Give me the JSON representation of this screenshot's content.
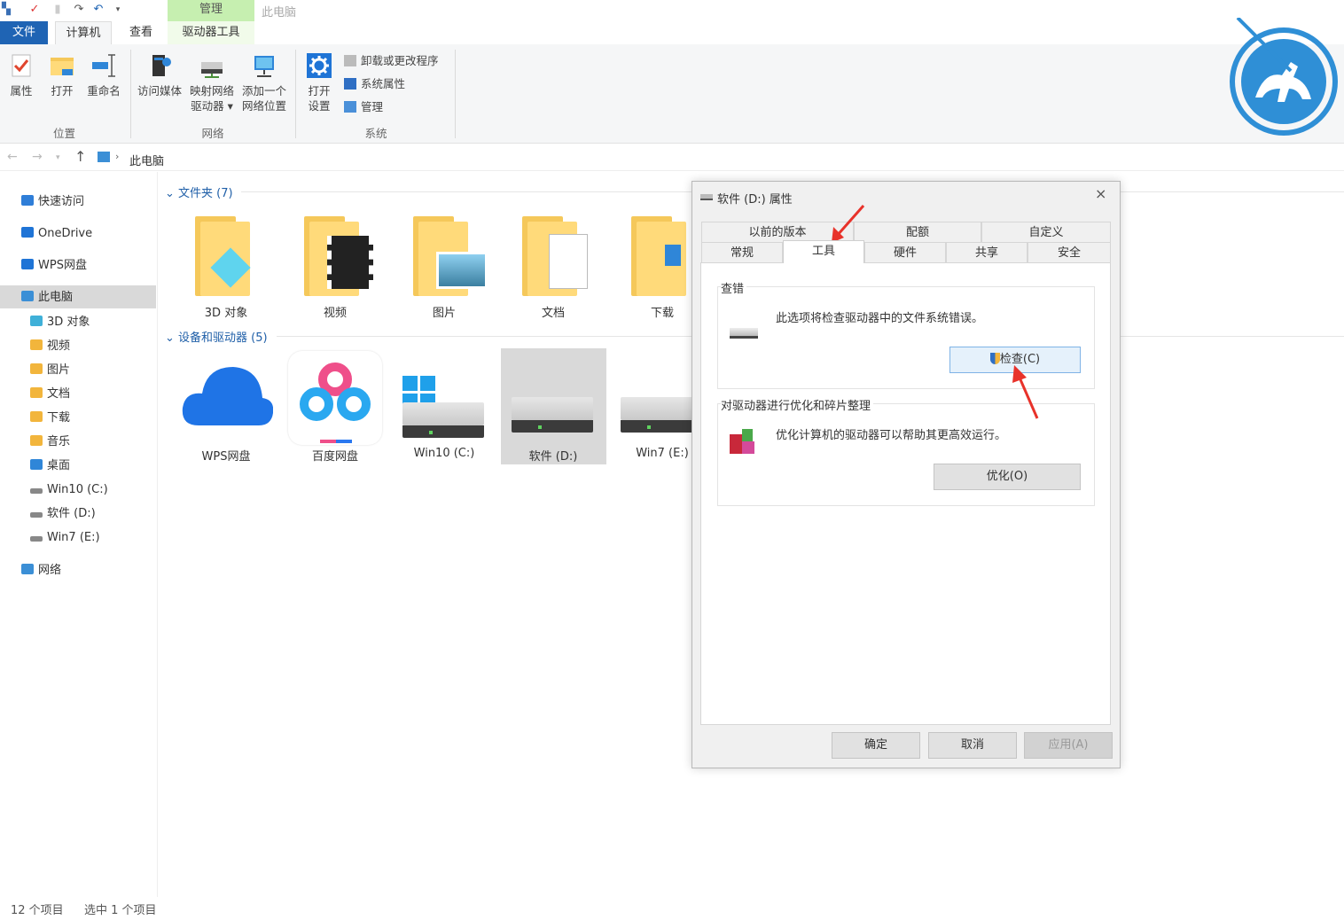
{
  "titlebar": {
    "context_group": "管理",
    "title": "此电脑"
  },
  "ribbon": {
    "tabs": [
      "文件",
      "计算机",
      "查看",
      "驱动器工具"
    ],
    "location": {
      "label": "位置",
      "buttons": [
        "属性",
        "打开",
        "重命名"
      ]
    },
    "network": {
      "label": "网络",
      "access_media": "访问媒体",
      "map_drive_l1": "映射网络",
      "map_drive_l2": "驱动器",
      "add_location_l1": "添加一个",
      "add_location_l2": "网络位置"
    },
    "system": {
      "label": "系统",
      "open_settings_l1": "打开",
      "open_settings_l2": "设置",
      "uninstall": "卸载或更改程序",
      "sys_props": "系统属性",
      "manage": "管理"
    }
  },
  "address": {
    "path": "此电脑"
  },
  "sidebar": {
    "items": [
      {
        "label": "快速访问",
        "color": "#2f7ed8"
      },
      {
        "label": "OneDrive",
        "color": "#1f74d6"
      },
      {
        "label": "WPS网盘",
        "color": "#1f74d6"
      },
      {
        "label": "此电脑",
        "color": "#3b8fd6"
      },
      {
        "label": "3D 对象",
        "color": "#3fb0d8"
      },
      {
        "label": "视频",
        "color": "#f2b53c"
      },
      {
        "label": "图片",
        "color": "#f2b53c"
      },
      {
        "label": "文档",
        "color": "#f2b53c"
      },
      {
        "label": "下载",
        "color": "#f2b53c"
      },
      {
        "label": "音乐",
        "color": "#f2b53c"
      },
      {
        "label": "桌面",
        "color": "#2f86d8"
      },
      {
        "label": "Win10 (C:)",
        "color": "#888888"
      },
      {
        "label": "软件 (D:)",
        "color": "#888888"
      },
      {
        "label": "Win7 (E:)",
        "color": "#888888"
      },
      {
        "label": "网络",
        "color": "#3b8fd6"
      }
    ]
  },
  "content": {
    "folders_header": "文件夹 (7)",
    "folders": [
      "3D 对象",
      "视频",
      "图片",
      "文档",
      "下载"
    ],
    "devices_header": "设备和驱动器 (5)",
    "devices": [
      "WPS网盘",
      "百度网盘",
      "Win10 (C:)",
      "软件 (D:)",
      "Win7 (E:)"
    ]
  },
  "status": {
    "count": "12 个项目",
    "selected": "选中 1 个项目"
  },
  "dialog": {
    "title": "软件 (D:) 属性",
    "close": "×",
    "tabs_row1": [
      "以前的版本",
      "配额",
      "自定义"
    ],
    "tabs_row2": [
      "常规",
      "工具",
      "硬件",
      "共享",
      "安全"
    ],
    "check_group": {
      "title": "查错",
      "text": "此选项将检查驱动器中的文件系统错误。",
      "button": "检查(C)"
    },
    "optimize_group": {
      "title": "对驱动器进行优化和碎片整理",
      "text": "优化计算机的驱动器可以帮助其更高效运行。",
      "button": "优化(O)"
    },
    "buttons": {
      "ok": "确定",
      "cancel": "取消",
      "apply": "应用(A)"
    }
  }
}
